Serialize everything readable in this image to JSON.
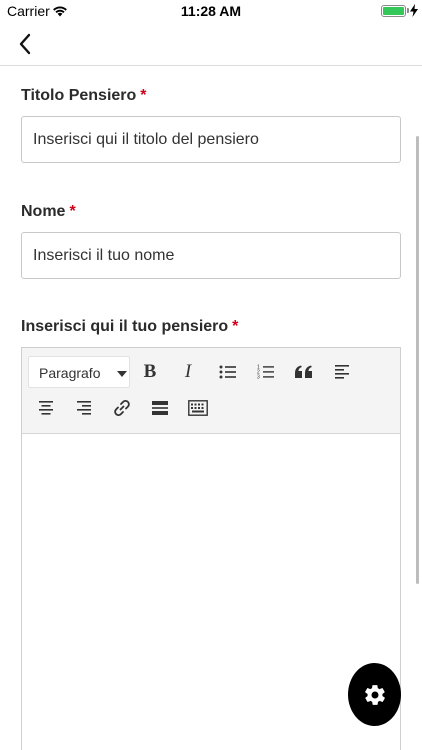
{
  "status_bar": {
    "carrier": "Carrier",
    "time": "11:28 AM",
    "battery_level": 1.0,
    "battery_color": "#34c759"
  },
  "nav": {
    "back_icon": "chevron-left-icon"
  },
  "form": {
    "title_field": {
      "label": "Titolo Pensiero",
      "required_mark": "*",
      "placeholder": "Inserisci qui il titolo del pensiero",
      "value": ""
    },
    "name_field": {
      "label": "Nome",
      "required_mark": "*",
      "placeholder": "Inserisci il tuo nome",
      "value": ""
    },
    "thought_field": {
      "label": "Inserisci qui il tuo pensiero",
      "required_mark": "*"
    }
  },
  "editor": {
    "heading_select": {
      "selected": "Paragrafo"
    },
    "toolbar": {
      "bold": "B",
      "italic": "I",
      "icons": [
        "bulleted-list-icon",
        "numbered-list-icon",
        "block-quote-icon",
        "align-left-icon",
        "align-center-icon",
        "align-right-icon",
        "link-icon",
        "horizontal-line-icon",
        "keyboard-icon"
      ]
    }
  },
  "fab": {
    "icon": "gear-icon"
  },
  "colors": {
    "required": "#d0021b",
    "toolbar_bg": "#f4f4f4",
    "fab_bg": "#000000"
  }
}
